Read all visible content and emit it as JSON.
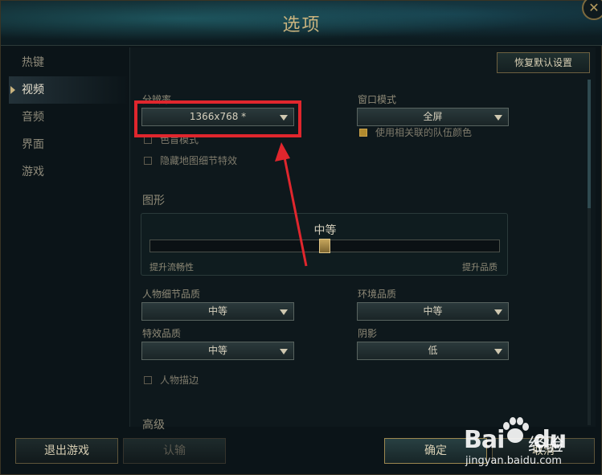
{
  "window": {
    "title": "选项",
    "close_symbol": "✕"
  },
  "sidebar": {
    "items": [
      {
        "label": "热键",
        "active": false
      },
      {
        "label": "视频",
        "active": true
      },
      {
        "label": "音频",
        "active": false
      },
      {
        "label": "界面",
        "active": false
      },
      {
        "label": "游戏",
        "active": false
      }
    ]
  },
  "toolbar": {
    "reset_label": "恢复默认设置"
  },
  "video": {
    "resolution": {
      "label": "分辨率",
      "value": "1366x768 *"
    },
    "window_mode": {
      "label": "窗口模式",
      "value": "全屏"
    },
    "colorblind_mode": {
      "label": "色盲模式",
      "checked": false
    },
    "hide_map_effects": {
      "label": "隐藏地图细节特效",
      "checked": false
    },
    "team_colors": {
      "label": "使用相关联的队伍颜色",
      "checked": true
    },
    "graphics": {
      "section_title": "图形",
      "preset_label": "中等",
      "slider_level": 0.5,
      "left_label": "提升流畅性",
      "right_label": "提升品质"
    },
    "character_quality": {
      "label": "人物细节品质",
      "value": "中等"
    },
    "environment_quality": {
      "label": "环境品质",
      "value": "中等"
    },
    "effects_quality": {
      "label": "特效品质",
      "value": "中等"
    },
    "shadows": {
      "label": "阴影",
      "value": "低"
    },
    "character_inking": {
      "label": "人物描边",
      "checked": false
    },
    "advanced_title": "高级"
  },
  "footer": {
    "exit_label": "退出游戏",
    "surrender_label": "认输",
    "ok_label": "确定",
    "cancel_label": "取消"
  },
  "watermark": {
    "logo": "Bai",
    "logo2": "du",
    "brand": "经验",
    "url": "jingyan.baidu.com"
  },
  "colors": {
    "accent_gold": "#c9b37e",
    "highlight_red": "#e0262d"
  }
}
